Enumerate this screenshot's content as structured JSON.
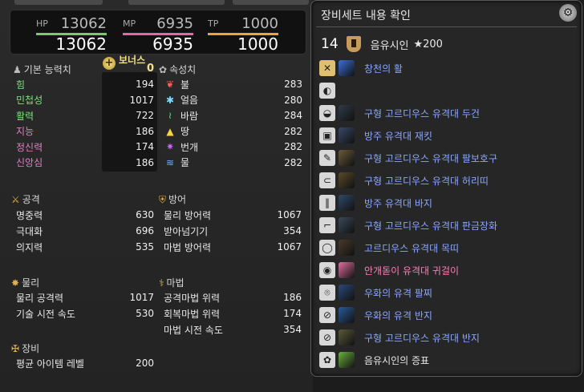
{
  "vitals": {
    "hp": {
      "label": "HP",
      "max": "13062",
      "current": "13062",
      "color": "#7cc96b"
    },
    "mp": {
      "label": "MP",
      "max": "6935",
      "current": "6935",
      "color": "#e06aa6"
    },
    "tp": {
      "label": "TP",
      "max": "1000",
      "current": "1000",
      "color": "#f0a040"
    }
  },
  "base": {
    "title": "기본 능력치",
    "bonus_label": "보너스",
    "bonus_value": "0",
    "stats": [
      {
        "label": "힘",
        "value": "194",
        "color": "#7de27d"
      },
      {
        "label": "민첩성",
        "value": "1017",
        "color": "#7de27d"
      },
      {
        "label": "활력",
        "value": "722",
        "color": "#7de27d"
      },
      {
        "label": "지능",
        "value": "186",
        "color": "#e67ec7"
      },
      {
        "label": "정신력",
        "value": "174",
        "color": "#e67ec7"
      },
      {
        "label": "신앙심",
        "value": "186",
        "color": "#e67ec7"
      }
    ]
  },
  "elements": {
    "title": "속성치",
    "items": [
      {
        "icon": "fire-icon",
        "label": "불",
        "value": "283",
        "color": "#ff5b5b"
      },
      {
        "icon": "ice-icon",
        "label": "얼음",
        "value": "280",
        "color": "#7fdcff"
      },
      {
        "icon": "wind-icon",
        "label": "바람",
        "value": "284",
        "color": "#4ee07b"
      },
      {
        "icon": "earth-icon",
        "label": "땅",
        "value": "282",
        "color": "#f6d34a"
      },
      {
        "icon": "lightning-icon",
        "label": "번개",
        "value": "282",
        "color": "#d067ff"
      },
      {
        "icon": "water-icon",
        "label": "물",
        "value": "282",
        "color": "#6db3ff"
      }
    ]
  },
  "offense": {
    "title": "공격",
    "stats": [
      {
        "label": "명중력",
        "value": "630"
      },
      {
        "label": "극대화",
        "value": "696"
      },
      {
        "label": "의지력",
        "value": "535"
      }
    ]
  },
  "defense": {
    "title": "방어",
    "stats": [
      {
        "label": "물리 방어력",
        "value": "1067"
      },
      {
        "label": "받아넘기기",
        "value": "354"
      },
      {
        "label": "마법 방어력",
        "value": "1067"
      }
    ]
  },
  "physical": {
    "title": "물리",
    "stats": [
      {
        "label": "물리 공격력",
        "value": "1017"
      },
      {
        "label": "기술 시전 속도",
        "value": "530"
      }
    ]
  },
  "magic": {
    "title": "마법",
    "stats": [
      {
        "label": "공격마법 위력",
        "value": "186"
      },
      {
        "label": "회복마법 위력",
        "value": "174"
      },
      {
        "label": "마법 시전 속도",
        "value": "354"
      }
    ]
  },
  "gear_section": {
    "title": "장비",
    "stats": [
      {
        "label": "평균 아이템 레벨",
        "value": "200"
      }
    ]
  },
  "tooltip": {
    "title": "장비세트 내용 확인",
    "level": "14",
    "set_name": "음유시인",
    "item_level": "★200",
    "items": [
      {
        "slot": "weapon",
        "name": "창천의 활",
        "color": "blue",
        "icon_color": "#3a6fd8"
      },
      {
        "slot": "offhand",
        "name": "",
        "color": "blue",
        "icon_color": ""
      },
      {
        "slot": "head",
        "name": "구형 고르디우스 유격대 두건",
        "color": "blue",
        "icon_color": "#2f3a4a"
      },
      {
        "slot": "body",
        "name": "방주 유격대 재킷",
        "color": "blue",
        "icon_color": "#394a6a"
      },
      {
        "slot": "hands",
        "name": "구형 고르디우스 유격대 팔보호구",
        "color": "blue",
        "icon_color": "#6a5a3a"
      },
      {
        "slot": "waist",
        "name": "구형 고르디우스 유격대 허리띠",
        "color": "blue",
        "icon_color": "#5a4a2a"
      },
      {
        "slot": "legs",
        "name": "방주 유격대 바지",
        "color": "blue",
        "icon_color": "#2f4a6a"
      },
      {
        "slot": "feet",
        "name": "구형 고르디우스 유격대 판금장화",
        "color": "blue",
        "icon_color": "#3a4a5a"
      },
      {
        "slot": "neck",
        "name": "고르디우스 유격대 목띠",
        "color": "blue",
        "icon_color": "#4a3a2a"
      },
      {
        "slot": "ears",
        "name": "안개돋이 유격대 귀걸이",
        "color": "pink",
        "icon_color": "#e070a0"
      },
      {
        "slot": "wrist",
        "name": "우화의 유격 팔찌",
        "color": "blue",
        "icon_color": "#2a4a7a"
      },
      {
        "slot": "ring1",
        "name": "우화의 유격 반지",
        "color": "blue",
        "icon_color": "#2a5a9a"
      },
      {
        "slot": "ring2",
        "name": "구형 고르디우스 유격대 반지",
        "color": "blue",
        "icon_color": "#5a5a3a"
      },
      {
        "slot": "soul",
        "name": "음유시인의 증표",
        "color": "white",
        "icon_color": "#6ab040"
      }
    ]
  }
}
